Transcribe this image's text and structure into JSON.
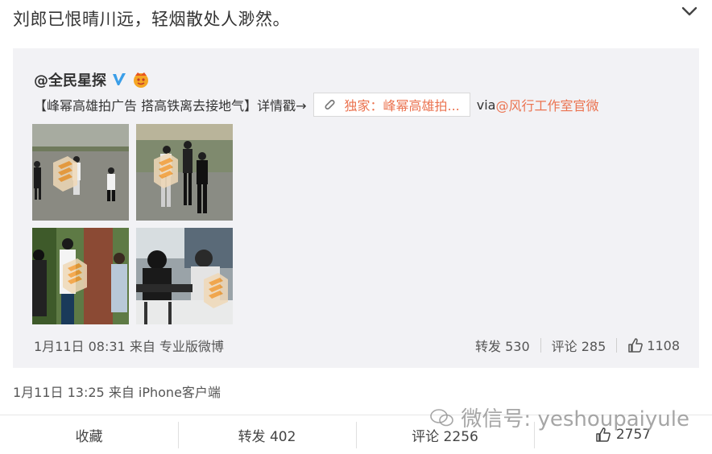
{
  "post": {
    "text": "刘郎已恨晴川远，轻烟散处人渺然。",
    "meta": "1月11日 13:25 来自 iPhone客户端"
  },
  "repost": {
    "author": "@全民星探",
    "text_prefix": "【峰幂高雄拍广告 搭高铁离去接地气】详情戳→",
    "link_label": "独家：峰幂高雄拍...",
    "via_label": "via",
    "via_author": "@风行工作室官微",
    "meta": "1月11日 08:31 来自 专业版微博",
    "actions": {
      "repost_label": "转发 530",
      "comment_label": "评论 285",
      "like_count": "1108"
    }
  },
  "bottom_bar": {
    "favorite_label": "收藏",
    "repost_label": "转发 402",
    "comment_label": "评论 2256",
    "like_count": "2757"
  },
  "watermark": {
    "text": "微信号: yeshoupaiyule"
  },
  "colors": {
    "link": "#eb7350",
    "verified": "#3a9ee8",
    "card_bg": "#f2f2f5"
  }
}
